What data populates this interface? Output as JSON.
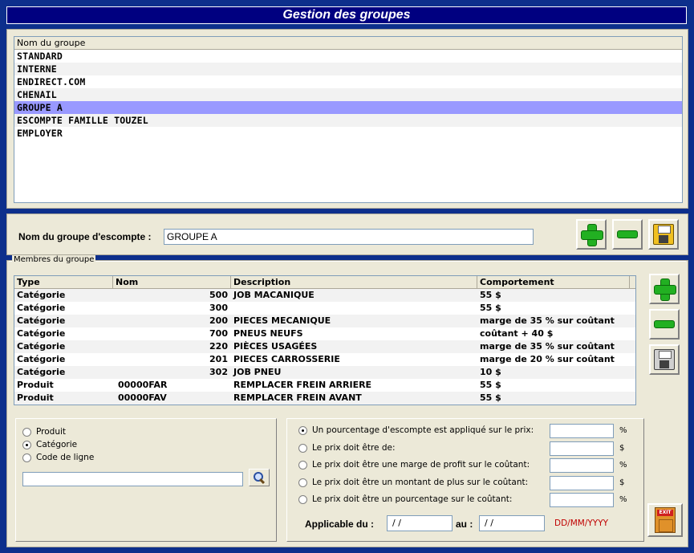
{
  "window": {
    "title": "Gestion des groupes"
  },
  "groups_list": {
    "header": "Nom du groupe",
    "items": [
      "STANDARD",
      "INTERNE",
      "ENDIRECT.COM",
      "CHENAIL",
      "GROUPE A",
      "ESCOMPTE FAMILLE TOUZEL",
      "EMPLOYER"
    ],
    "selected": "GROUPE A"
  },
  "group_name": {
    "label": "Nom du groupe d'escompte :",
    "value": "GROUPE A"
  },
  "members": {
    "legend": "Membres du groupe",
    "columns": [
      "Type",
      "Nom",
      "Description",
      "Comportement"
    ],
    "rows": [
      {
        "type": "Catégorie",
        "nom": "500",
        "description": "JOB MACANIQUE",
        "comportement": "55 $"
      },
      {
        "type": "Catégorie",
        "nom": "300",
        "description": "",
        "comportement": "55 $"
      },
      {
        "type": "Catégorie",
        "nom": "200",
        "description": "PIECES MECANIQUE",
        "comportement": "marge de 35 % sur coûtant"
      },
      {
        "type": "Catégorie",
        "nom": "700",
        "description": "PNEUS NEUFS",
        "comportement": "coûtant + 40 $"
      },
      {
        "type": "Catégorie",
        "nom": "220",
        "description": "PIÈCES USAGÉES",
        "comportement": "marge de 35 % sur coûtant"
      },
      {
        "type": "Catégorie",
        "nom": "201",
        "description": "PIECES CARROSSERIE",
        "comportement": "marge de 20 % sur coûtant"
      },
      {
        "type": "Catégorie",
        "nom": "302",
        "description": "JOB PNEU",
        "comportement": "10 $"
      },
      {
        "type": "Produit",
        "nom": "00000FAR",
        "description": "REMPLACER FREIN ARRIERE",
        "comportement": "55 $"
      },
      {
        "type": "Produit",
        "nom": "00000FAV",
        "description": "REMPLACER FREIN AVANT",
        "comportement": "55 $"
      }
    ]
  },
  "type_options": {
    "items": [
      "Produit",
      "Catégorie",
      "Code de ligne"
    ],
    "selected": "Catégorie",
    "search_value": ""
  },
  "pricing": {
    "options": [
      {
        "label": "Un pourcentage d'escompte est appliqué sur le prix:",
        "unit": "%",
        "value": ""
      },
      {
        "label": "Le prix doit être de:",
        "unit": "$",
        "value": ""
      },
      {
        "label": "Le prix doit être une marge de profit sur le coûtant:",
        "unit": "%",
        "value": ""
      },
      {
        "label": "Le prix doit être un montant de plus sur le coûtant:",
        "unit": "$",
        "value": ""
      },
      {
        "label": "Le prix doit être un pourcentage sur le coûtant:",
        "unit": "%",
        "value": ""
      }
    ],
    "selected_index": 0,
    "applicable_from_label": "Applicable du :",
    "applicable_from_value": " / /",
    "applicable_to_label": "au :",
    "applicable_to_value": " / /",
    "date_format_hint": "DD/MM/YYYY"
  },
  "buttons": {
    "exit_label": "EXIT"
  },
  "icons": {
    "add": "plus-icon",
    "remove": "minus-icon",
    "save": "floppy-disk-icon",
    "search": "magnifier-icon",
    "exit": "exit-door-icon"
  },
  "colors": {
    "title_bar": "#000080",
    "selected_row": "#9999ff",
    "frame": "#0d2f8c",
    "date_hint": "#c00000"
  }
}
